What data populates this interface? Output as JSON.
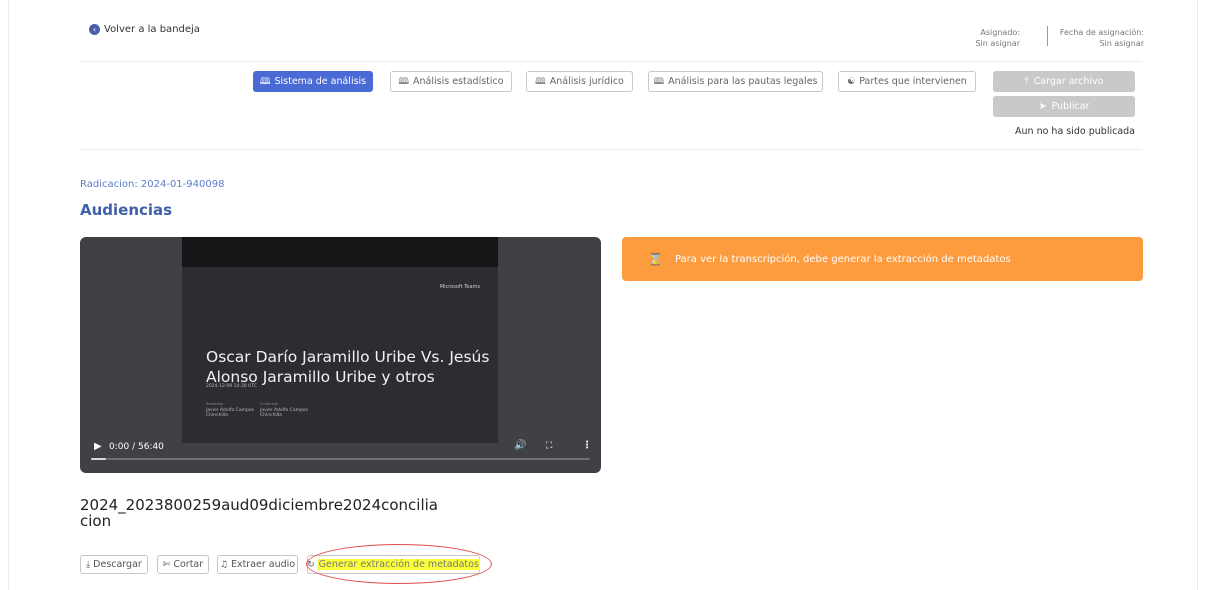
{
  "nav": {
    "back_label": "Volver a la bandeja"
  },
  "assignment": {
    "assigned_label": "Asignado:",
    "assigned_value": "Sin asignar",
    "date_label": "Fecha de asignación:",
    "date_value": "Sin asignar"
  },
  "tabs": [
    {
      "label": "Sistema de análisis",
      "icon": "book-icon",
      "active": true
    },
    {
      "label": "Análisis estadístico",
      "icon": "book-icon",
      "active": false
    },
    {
      "label": "Análisis jurídico",
      "icon": "book-icon",
      "active": false
    },
    {
      "label": "Análisis para las pautas legales",
      "icon": "book-icon",
      "active": false
    },
    {
      "label": "Partes que intervienen",
      "icon": "people-icon",
      "active": false
    }
  ],
  "actions": {
    "upload_label": "Cargar archivo",
    "publish_label": "Publicar",
    "publish_status": "Aun no ha sido publicada"
  },
  "case": {
    "radicacion": "Radicacion: 2024-01-940098",
    "section_title": "Audiencias"
  },
  "video": {
    "slide_brand": "Microsoft Teams",
    "slide_title": "Oscar Darío Jaramillo Uribe Vs. Jesús Alonso Jaramillo Uribe y otros",
    "slide_date": "2024-12-09 14:30 UTC",
    "slide_col1_label": "Realizado",
    "slide_col1_value": "Javier Adolfo Campos Chinchilla",
    "slide_col2_label": "Contenido",
    "slide_col2_value": "Javier Adolfo Campos Chinchilla",
    "time": "0:00 / 56:40",
    "progress": 0.03
  },
  "alert": {
    "text": "Para ver la transcripción, debe generar la extracción de metadatos"
  },
  "file": {
    "name": "2024_2023800259aud09diciembre2024conciliacion"
  },
  "file_actions": [
    {
      "label": "Descargar",
      "icon": "download-icon"
    },
    {
      "label": "Cortar",
      "icon": "scissors-icon"
    },
    {
      "label": "Extraer audio",
      "icon": "audio-icon"
    },
    {
      "label": "Generar extracción de metadatos",
      "icon": "refresh-icon"
    }
  ]
}
